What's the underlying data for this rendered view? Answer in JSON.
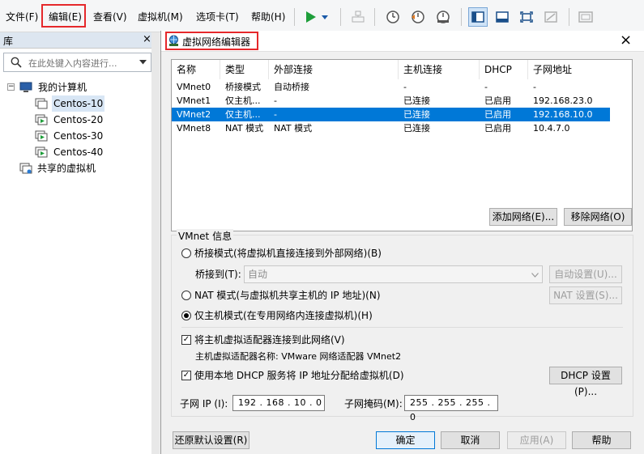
{
  "menubar": {
    "items": [
      "文件(F)",
      "编辑(E)",
      "查看(V)",
      "虚拟机(M)",
      "选项卡(T)",
      "帮助(H)"
    ]
  },
  "library": {
    "title": "库",
    "close": "×",
    "search_placeholder": "在此处键入内容进行...",
    "tree": {
      "root": "我的计算机",
      "vms": [
        "Centos-10",
        "Centos-20",
        "Centos-30",
        "Centos-40"
      ],
      "shared": "共享的虚拟机"
    }
  },
  "dialog": {
    "title": "虚拟网络编辑器",
    "close": "×",
    "table": {
      "headers": [
        "名称",
        "类型",
        "外部连接",
        "主机连接",
        "DHCP",
        "子网地址"
      ],
      "rows": [
        [
          "VMnet0",
          "桥接模式",
          "自动桥接",
          "-",
          "-",
          "-"
        ],
        [
          "VMnet1",
          "仅主机...",
          "-",
          "已连接",
          "已启用",
          "192.168.23.0"
        ],
        [
          "VMnet2",
          "仅主机...",
          "-",
          "已连接",
          "已启用",
          "192.168.10.0"
        ],
        [
          "VMnet8",
          "NAT 模式",
          "NAT 模式",
          "已连接",
          "已启用",
          "10.4.7.0"
        ]
      ],
      "selected_row": 2
    },
    "add_network": "添加网络(E)...",
    "remove_network": "移除网络(O)",
    "vmnet_info": {
      "title": "VMnet 信息",
      "bridged": "桥接模式(将虚拟机直接连接到外部网络)(B)",
      "bridged_to_label": "桥接到(T):",
      "bridged_to_value": "自动",
      "auto_settings": "自动设置(U)...",
      "nat": "NAT 模式(与虚拟机共享主机的 IP 地址)(N)",
      "nat_settings": "NAT 设置(S)...",
      "host_only": "仅主机模式(在专用网络内连接虚拟机)(H)",
      "connect_adapter": "将主机虚拟适配器连接到此网络(V)",
      "adapter_name": "主机虚拟适配器名称: VMware 网络适配器 VMnet2",
      "use_dhcp": "使用本地 DHCP 服务将 IP 地址分配给虚拟机(D)",
      "dhcp_settings": "DHCP 设置(P)...",
      "subnet_ip_label": "子网 IP (I):",
      "subnet_ip": "192 . 168 . 10 . 0",
      "subnet_mask_label": "子网掩码(M):",
      "subnet_mask": "255 . 255 . 255 . 0",
      "selected_mode": "host_only"
    },
    "footer": {
      "restore": "还原默认设置(R)",
      "ok": "确定",
      "cancel": "取消",
      "apply": "应用(A)",
      "help": "帮助"
    }
  },
  "colors": {
    "highlight_red": "#e5282b",
    "selection_blue": "#0078d7",
    "play_green": "#1e9e3a"
  }
}
